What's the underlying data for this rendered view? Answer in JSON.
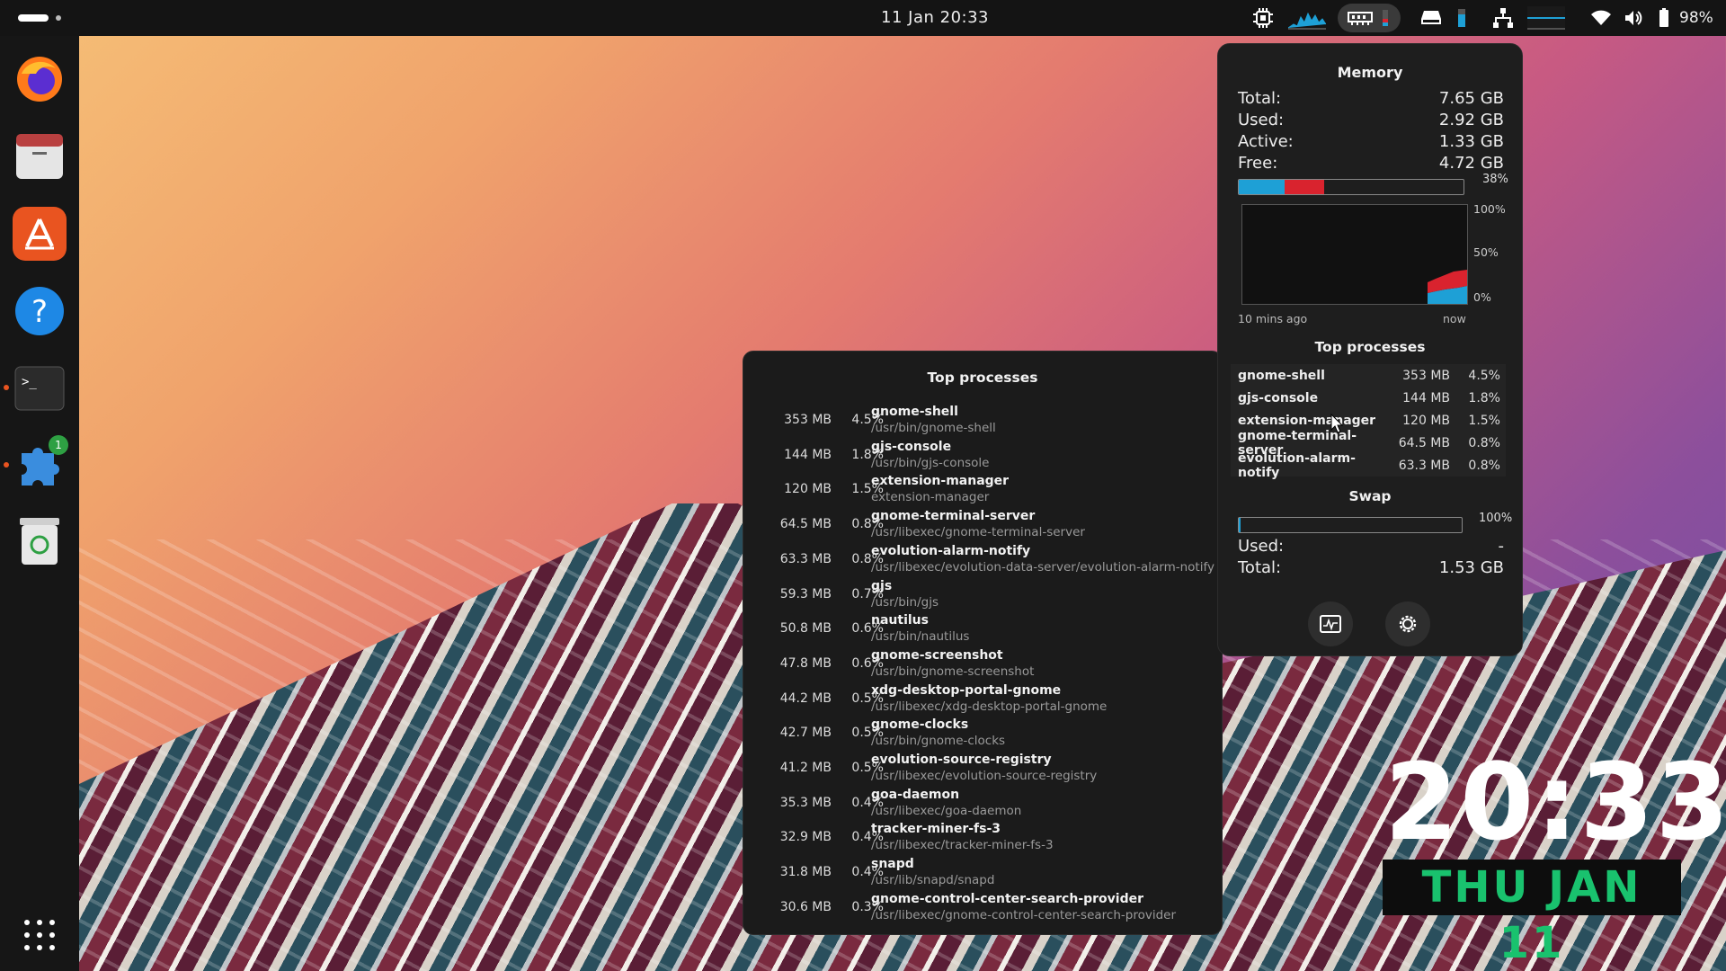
{
  "topbar": {
    "datetime": "11 Jan  20:33",
    "battery_percent": "98%",
    "indicators": [
      "cpu-icon",
      "cpu-graph-icon",
      "memory-icon",
      "disk-icon",
      "network-icon",
      "wifi-icon",
      "volume-icon",
      "battery-icon"
    ]
  },
  "dock": {
    "apps": [
      "firefox",
      "files",
      "app-center",
      "help",
      "terminal",
      "extension-manager",
      "trash"
    ],
    "extension_badge": "1"
  },
  "memory_popup": {
    "title": "Memory",
    "rows": [
      {
        "label": "Total:",
        "value": "7.65 GB"
      },
      {
        "label": "Used:",
        "value": "2.92 GB"
      },
      {
        "label": "Active:",
        "value": "1.33 GB"
      },
      {
        "label": "Free:",
        "value": "4.72 GB"
      }
    ],
    "usage_percent_label": "38%",
    "usage_fraction": 0.38,
    "graph": {
      "y_top": "100%",
      "y_mid": "50%",
      "y_bot": "0%",
      "x_left": "10 mins ago",
      "x_right": "now"
    },
    "top_title": "Top processes",
    "top": [
      {
        "name": "gnome-shell",
        "mem": "353 MB",
        "pct": "4.5%"
      },
      {
        "name": "gjs-console",
        "mem": "144 MB",
        "pct": "1.8%"
      },
      {
        "name": "extension-manager",
        "mem": "120 MB",
        "pct": "1.5%"
      },
      {
        "name": "gnome-terminal-server",
        "mem": "64.5 MB",
        "pct": "0.8%"
      },
      {
        "name": "evolution-alarm-notify",
        "mem": "63.3 MB",
        "pct": "0.8%"
      }
    ],
    "swap": {
      "title": "Swap",
      "percent": "100%",
      "used_label": "Used:",
      "used_value": "-",
      "total_label": "Total:",
      "total_value": "1.53 GB"
    }
  },
  "big_popup": {
    "title": "Top processes",
    "rows": [
      {
        "mem": "353 MB",
        "pct": "4.5%",
        "name": "gnome-shell",
        "cmd": "/usr/bin/gnome-shell"
      },
      {
        "mem": "144 MB",
        "pct": "1.8%",
        "name": "gjs-console",
        "cmd": "/usr/bin/gjs-console"
      },
      {
        "mem": "120 MB",
        "pct": "1.5%",
        "name": "extension-manager",
        "cmd": "extension-manager"
      },
      {
        "mem": "64.5 MB",
        "pct": "0.8%",
        "name": "gnome-terminal-server",
        "cmd": "/usr/libexec/gnome-terminal-server"
      },
      {
        "mem": "63.3 MB",
        "pct": "0.8%",
        "name": "evolution-alarm-notify",
        "cmd": "/usr/libexec/evolution-data-server/evolution-alarm-notify"
      },
      {
        "mem": "59.3 MB",
        "pct": "0.7%",
        "name": "gjs",
        "cmd": "/usr/bin/gjs"
      },
      {
        "mem": "50.8 MB",
        "pct": "0.6%",
        "name": "nautilus",
        "cmd": "/usr/bin/nautilus"
      },
      {
        "mem": "47.8 MB",
        "pct": "0.6%",
        "name": "gnome-screenshot",
        "cmd": "/usr/bin/gnome-screenshot"
      },
      {
        "mem": "44.2 MB",
        "pct": "0.5%",
        "name": "xdg-desktop-portal-gnome",
        "cmd": "/usr/libexec/xdg-desktop-portal-gnome"
      },
      {
        "mem": "42.7 MB",
        "pct": "0.5%",
        "name": "gnome-clocks",
        "cmd": "/usr/bin/gnome-clocks"
      },
      {
        "mem": "41.2 MB",
        "pct": "0.5%",
        "name": "evolution-source-registry",
        "cmd": "/usr/libexec/evolution-source-registry"
      },
      {
        "mem": "35.3 MB",
        "pct": "0.4%",
        "name": "goa-daemon",
        "cmd": "/usr/libexec/goa-daemon"
      },
      {
        "mem": "32.9 MB",
        "pct": "0.4%",
        "name": "tracker-miner-fs-3",
        "cmd": "/usr/libexec/tracker-miner-fs-3"
      },
      {
        "mem": "31.8 MB",
        "pct": "0.4%",
        "name": "snapd",
        "cmd": "/usr/lib/snapd/snapd"
      },
      {
        "mem": "30.6 MB",
        "pct": "0.3%",
        "name": "gnome-control-center-search-provider",
        "cmd": "/usr/libexec/gnome-control-center-search-provider"
      }
    ]
  },
  "desktop_clock": {
    "time": "20:33",
    "date": "THU JAN 11"
  },
  "colors": {
    "accent_blue": "#1ea0d6",
    "accent_red": "#d9232e",
    "date_green": "#19c26e"
  }
}
